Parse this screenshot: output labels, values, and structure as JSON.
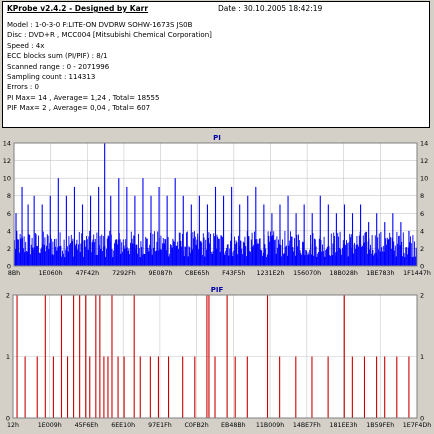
{
  "header": {
    "title": "KProbe v2.4.2 - Designed by Karr",
    "date": "Date : 30.10.2005 18:42:19"
  },
  "info_lines": [
    "Model : 1-0-3-0 F:LITE-ON DVDRW SOHW-1673S JS0B",
    "Disc : DVD+R , MCC004 [Mitsubishi Chemical Corporation]",
    "Speed : 4x",
    "ECC blocks sum (PI/PIF) : 8/1",
    "Scanned range : 0 - 2071996",
    "Sampling count : 114313",
    "Errors : 0",
    "PI Max= 14 , Average= 1,24 , Total= 18555",
    "PIF Max= 2 , Average= 0,04 , Total= 607"
  ],
  "colors": {
    "pi_bars": "#0000ff",
    "pif_bars": "#cc0000",
    "grid": "#c8c8c8",
    "title_text": "#0000aa"
  },
  "chart_data": [
    {
      "type": "bar",
      "title": "PI",
      "ylim": [
        0,
        14
      ],
      "yticks": [
        0,
        2,
        4,
        6,
        8,
        10,
        12,
        14
      ],
      "xlabels": [
        "8Bh",
        "1E060h",
        "47F42h",
        "7292Fh",
        "9E087h",
        "C8E65h",
        "F43F5h",
        "1231E2h",
        "156070h",
        "18B028h",
        "1BE783h",
        "1F1447h"
      ],
      "baseline_band": [
        1,
        4
      ],
      "spikes": [
        [
          0.005,
          6
        ],
        [
          0.02,
          9
        ],
        [
          0.035,
          7
        ],
        [
          0.05,
          8
        ],
        [
          0.07,
          7
        ],
        [
          0.09,
          8
        ],
        [
          0.11,
          10
        ],
        [
          0.13,
          8
        ],
        [
          0.15,
          9
        ],
        [
          0.17,
          7
        ],
        [
          0.19,
          8
        ],
        [
          0.21,
          9
        ],
        [
          0.225,
          14
        ],
        [
          0.24,
          8
        ],
        [
          0.26,
          10
        ],
        [
          0.28,
          9
        ],
        [
          0.3,
          8
        ],
        [
          0.32,
          10
        ],
        [
          0.34,
          8
        ],
        [
          0.36,
          9
        ],
        [
          0.38,
          8
        ],
        [
          0.4,
          10
        ],
        [
          0.42,
          8
        ],
        [
          0.44,
          7
        ],
        [
          0.46,
          8
        ],
        [
          0.48,
          7
        ],
        [
          0.5,
          9
        ],
        [
          0.52,
          8
        ],
        [
          0.54,
          9
        ],
        [
          0.56,
          7
        ],
        [
          0.58,
          8
        ],
        [
          0.6,
          9
        ],
        [
          0.62,
          7
        ],
        [
          0.64,
          6
        ],
        [
          0.66,
          7
        ],
        [
          0.68,
          8
        ],
        [
          0.7,
          6
        ],
        [
          0.72,
          7
        ],
        [
          0.74,
          6
        ],
        [
          0.76,
          8
        ],
        [
          0.78,
          7
        ],
        [
          0.8,
          6
        ],
        [
          0.82,
          7
        ],
        [
          0.84,
          6
        ],
        [
          0.86,
          7
        ],
        [
          0.88,
          5
        ],
        [
          0.9,
          6
        ],
        [
          0.92,
          5
        ],
        [
          0.94,
          6
        ],
        [
          0.96,
          5
        ],
        [
          0.98,
          4
        ]
      ]
    },
    {
      "type": "bar",
      "title": "PIF",
      "ylim": [
        0,
        2
      ],
      "yticks": [
        0,
        1,
        2
      ],
      "xlabels": [
        "12h",
        "1E009h",
        "45F6Eh",
        "6EE10h",
        "97E1Fh",
        "C0FB2h",
        "EB48Bh",
        "11B009h",
        "14BE7Fh",
        "181EE3h",
        "1B59FEh",
        "1E7F4Dh"
      ],
      "spikes": [
        [
          0.01,
          2
        ],
        [
          0.03,
          1
        ],
        [
          0.06,
          1
        ],
        [
          0.08,
          2
        ],
        [
          0.1,
          1
        ],
        [
          0.12,
          2
        ],
        [
          0.135,
          1
        ],
        [
          0.15,
          2
        ],
        [
          0.165,
          2
        ],
        [
          0.18,
          2
        ],
        [
          0.19,
          1
        ],
        [
          0.205,
          2
        ],
        [
          0.215,
          2
        ],
        [
          0.225,
          1
        ],
        [
          0.235,
          1
        ],
        [
          0.245,
          2
        ],
        [
          0.26,
          1
        ],
        [
          0.275,
          1
        ],
        [
          0.3,
          2
        ],
        [
          0.315,
          1
        ],
        [
          0.34,
          1
        ],
        [
          0.36,
          1
        ],
        [
          0.385,
          1
        ],
        [
          0.42,
          1
        ],
        [
          0.45,
          1
        ],
        [
          0.48,
          2
        ],
        [
          0.485,
          2
        ],
        [
          0.5,
          1
        ],
        [
          0.53,
          2
        ],
        [
          0.55,
          1
        ],
        [
          0.58,
          1
        ],
        [
          0.63,
          2
        ],
        [
          0.66,
          1
        ],
        [
          0.7,
          1
        ],
        [
          0.74,
          1
        ],
        [
          0.78,
          1
        ],
        [
          0.82,
          2
        ],
        [
          0.84,
          1
        ],
        [
          0.87,
          1
        ],
        [
          0.9,
          1
        ],
        [
          0.92,
          1
        ],
        [
          0.95,
          1
        ],
        [
          0.98,
          1
        ]
      ]
    }
  ]
}
